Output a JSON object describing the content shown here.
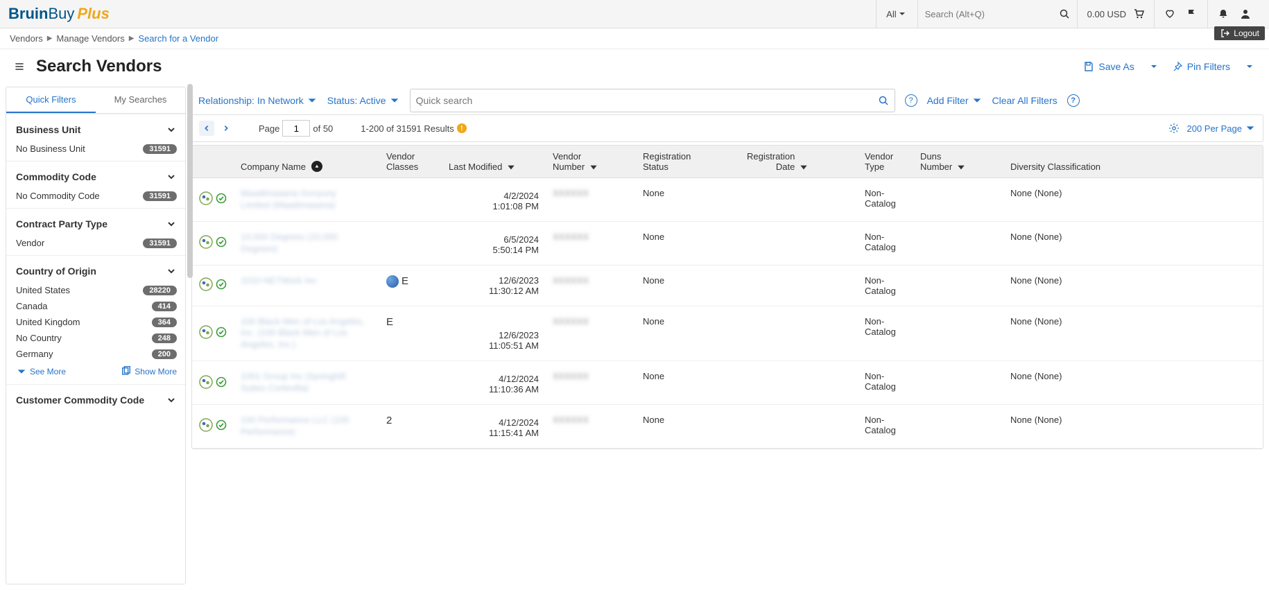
{
  "top": {
    "logo1": "Bruin",
    "logo2": "Buy",
    "logo3": "Plus",
    "all": "All",
    "search_placeholder": "Search (Alt+Q)",
    "cart_amount": "0.00 USD",
    "logout": "Logout"
  },
  "breadcrumb": {
    "a": "Vendors",
    "b": "Manage Vendors",
    "c": "Search for a Vendor"
  },
  "page": {
    "title": "Search Vendors",
    "save_as": "Save As",
    "pin": "Pin Filters"
  },
  "tabs": {
    "quick": "Quick Filters",
    "my": "My Searches"
  },
  "sidebar": {
    "bu": {
      "head": "Business Unit",
      "row": "No Business Unit",
      "cnt": "31591"
    },
    "cc": {
      "head": "Commodity Code",
      "row": "No Commodity Code",
      "cnt": "31591"
    },
    "cpt": {
      "head": "Contract Party Type",
      "row": "Vendor",
      "cnt": "31591"
    },
    "coo": {
      "head": "Country of Origin",
      "r1": "United States",
      "c1": "28220",
      "r2": "Canada",
      "c2": "414",
      "r3": "United Kingdom",
      "c3": "364",
      "r4": "No Country",
      "c4": "248",
      "r5": "Germany",
      "c5": "200",
      "see_more": "See More",
      "show_more": "Show More"
    },
    "ccc": {
      "head": "Customer Commodity Code"
    }
  },
  "filters": {
    "relationship": "Relationship: In Network",
    "status": "Status: Active",
    "quick_ph": "Quick search",
    "add": "Add Filter",
    "clear": "Clear All Filters"
  },
  "pager": {
    "page_lbl": "Page",
    "page_val": "1",
    "of_total": "of 50",
    "results": "1-200 of 31591 Results",
    "per_page": "200 Per Page"
  },
  "cols": {
    "company": "Company Name",
    "vclass1": "Vendor",
    "vclass2": "Classes",
    "lastmod": "Last Modified",
    "vnum1": "Vendor",
    "vnum2": "Number",
    "regst1": "Registration",
    "regst2": "Status",
    "regdt1": "Registration",
    "regdt2": "Date",
    "vtype1": "Vendor",
    "vtype2": "Type",
    "duns1": "Duns",
    "duns2": "Number",
    "div": "Diversity Classification"
  },
  "rows": [
    {
      "name_a": "Maadimaaana Gonyuny",
      "name_b": "Limited (Maadimaaana)",
      "vclass": "",
      "date": "4/2/2024",
      "time": "1:01:08 PM",
      "vnum": "XXXXXX",
      "reg": "None",
      "vtype": "Non-Catalog",
      "div": "None (None)"
    },
    {
      "name_a": "10,000 Degrees (10,000",
      "name_b": "Degrees)",
      "vclass": "",
      "date": "6/5/2024",
      "time": "5:50:14 PM",
      "vnum": "XXXXXX",
      "reg": "None",
      "vtype": "Non-Catalog",
      "div": "None (None)"
    },
    {
      "name_a": "1010 NETWork Inc",
      "name_b": "",
      "vclass": "E",
      "globe": true,
      "date": "12/6/2023",
      "time": "11:30:12 AM",
      "vnum": "XXXXXX",
      "reg": "None",
      "vtype": "Non-Catalog",
      "div": "None (None)"
    },
    {
      "name_a": "100 Black Men of Los Angeles,",
      "name_b": "Inc. (100 Black Men of Los",
      "name_c": "Angeles, Inc.)",
      "vclass": "E",
      "date": "12/6/2023",
      "time": "11:05:51 AM",
      "vnum": "XXXXXX",
      "reg": "None",
      "vtype": "Non-Catalog",
      "div": "None (None)"
    },
    {
      "name_a": "1001 Group Inc (Springhill",
      "name_b": "Suites Cortevilla)",
      "vclass": "",
      "date": "4/12/2024",
      "time": "11:10:36 AM",
      "vnum": "XXXXXX",
      "reg": "None",
      "vtype": "Non-Catalog",
      "div": "None (None)"
    },
    {
      "name_a": "100 Performance LLC (100",
      "name_b": "Performance)",
      "vclass": "2",
      "date": "4/12/2024",
      "time": "11:15:41 AM",
      "vnum": "XXXXXX",
      "reg": "None",
      "vtype": "Non-Catalog",
      "div": "None (None)"
    }
  ]
}
